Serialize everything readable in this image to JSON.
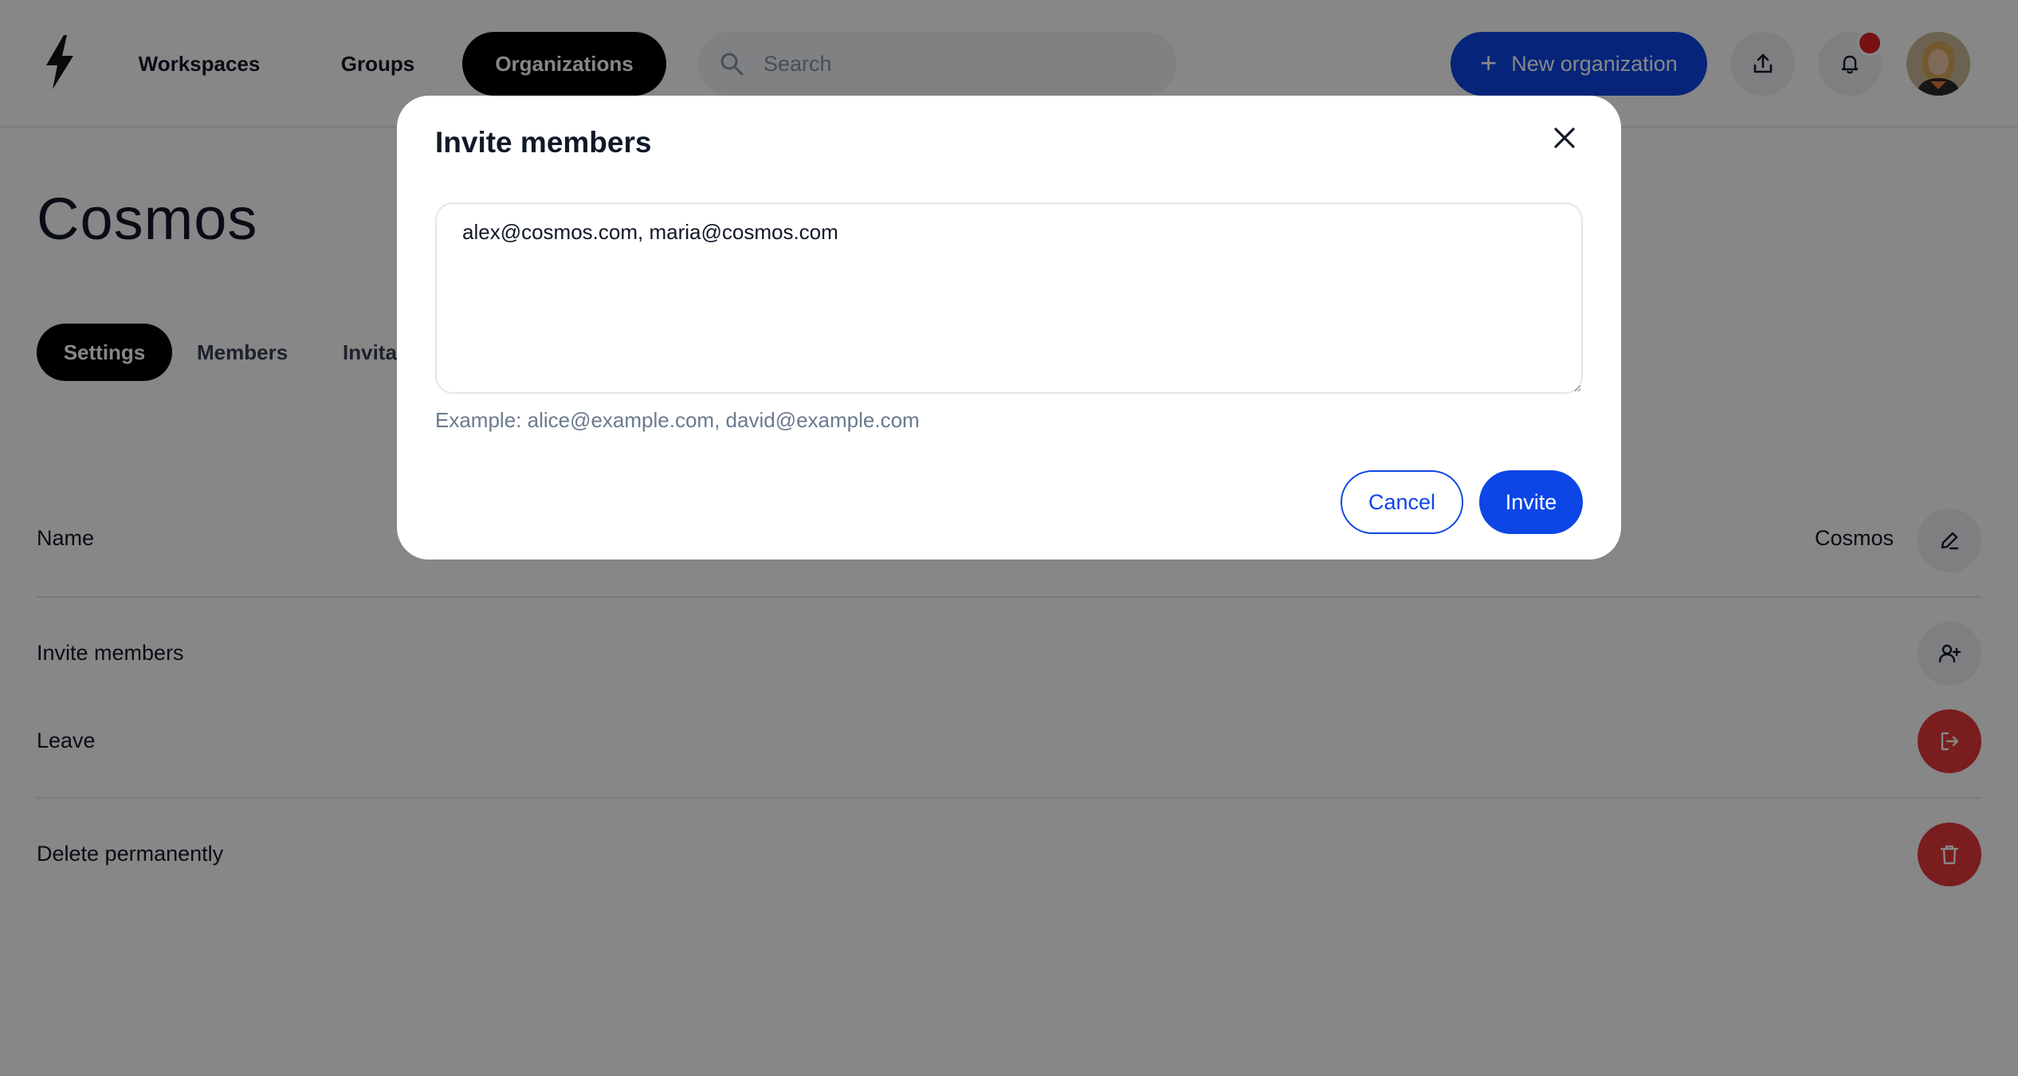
{
  "header": {
    "logo_icon": "lightning-bolt-icon",
    "nav": [
      {
        "label": "Workspaces",
        "active": false
      },
      {
        "label": "Groups",
        "active": false
      },
      {
        "label": "Organizations",
        "active": true
      }
    ],
    "search": {
      "placeholder": "Search",
      "value": ""
    },
    "new_org_label": "New organization",
    "notification_dot_color": "#e02020",
    "accent_color": "#0c46e6"
  },
  "page": {
    "title": "Cosmos",
    "tabs": [
      {
        "label": "Settings",
        "active": true
      },
      {
        "label": "Members",
        "active": false
      },
      {
        "label": "Invitations",
        "active": false
      }
    ],
    "rows": {
      "name": {
        "label": "Name",
        "value": "Cosmos"
      },
      "invite": {
        "label": "Invite members"
      },
      "leave": {
        "label": "Leave"
      },
      "delete": {
        "label": "Delete permanently"
      }
    },
    "danger_color": "#e5383b"
  },
  "modal": {
    "title": "Invite members",
    "emails_value": "alex@cosmos.com, maria@cosmos.com",
    "hint": "Example: alice@example.com, david@example.com",
    "cancel_label": "Cancel",
    "invite_label": "Invite"
  }
}
